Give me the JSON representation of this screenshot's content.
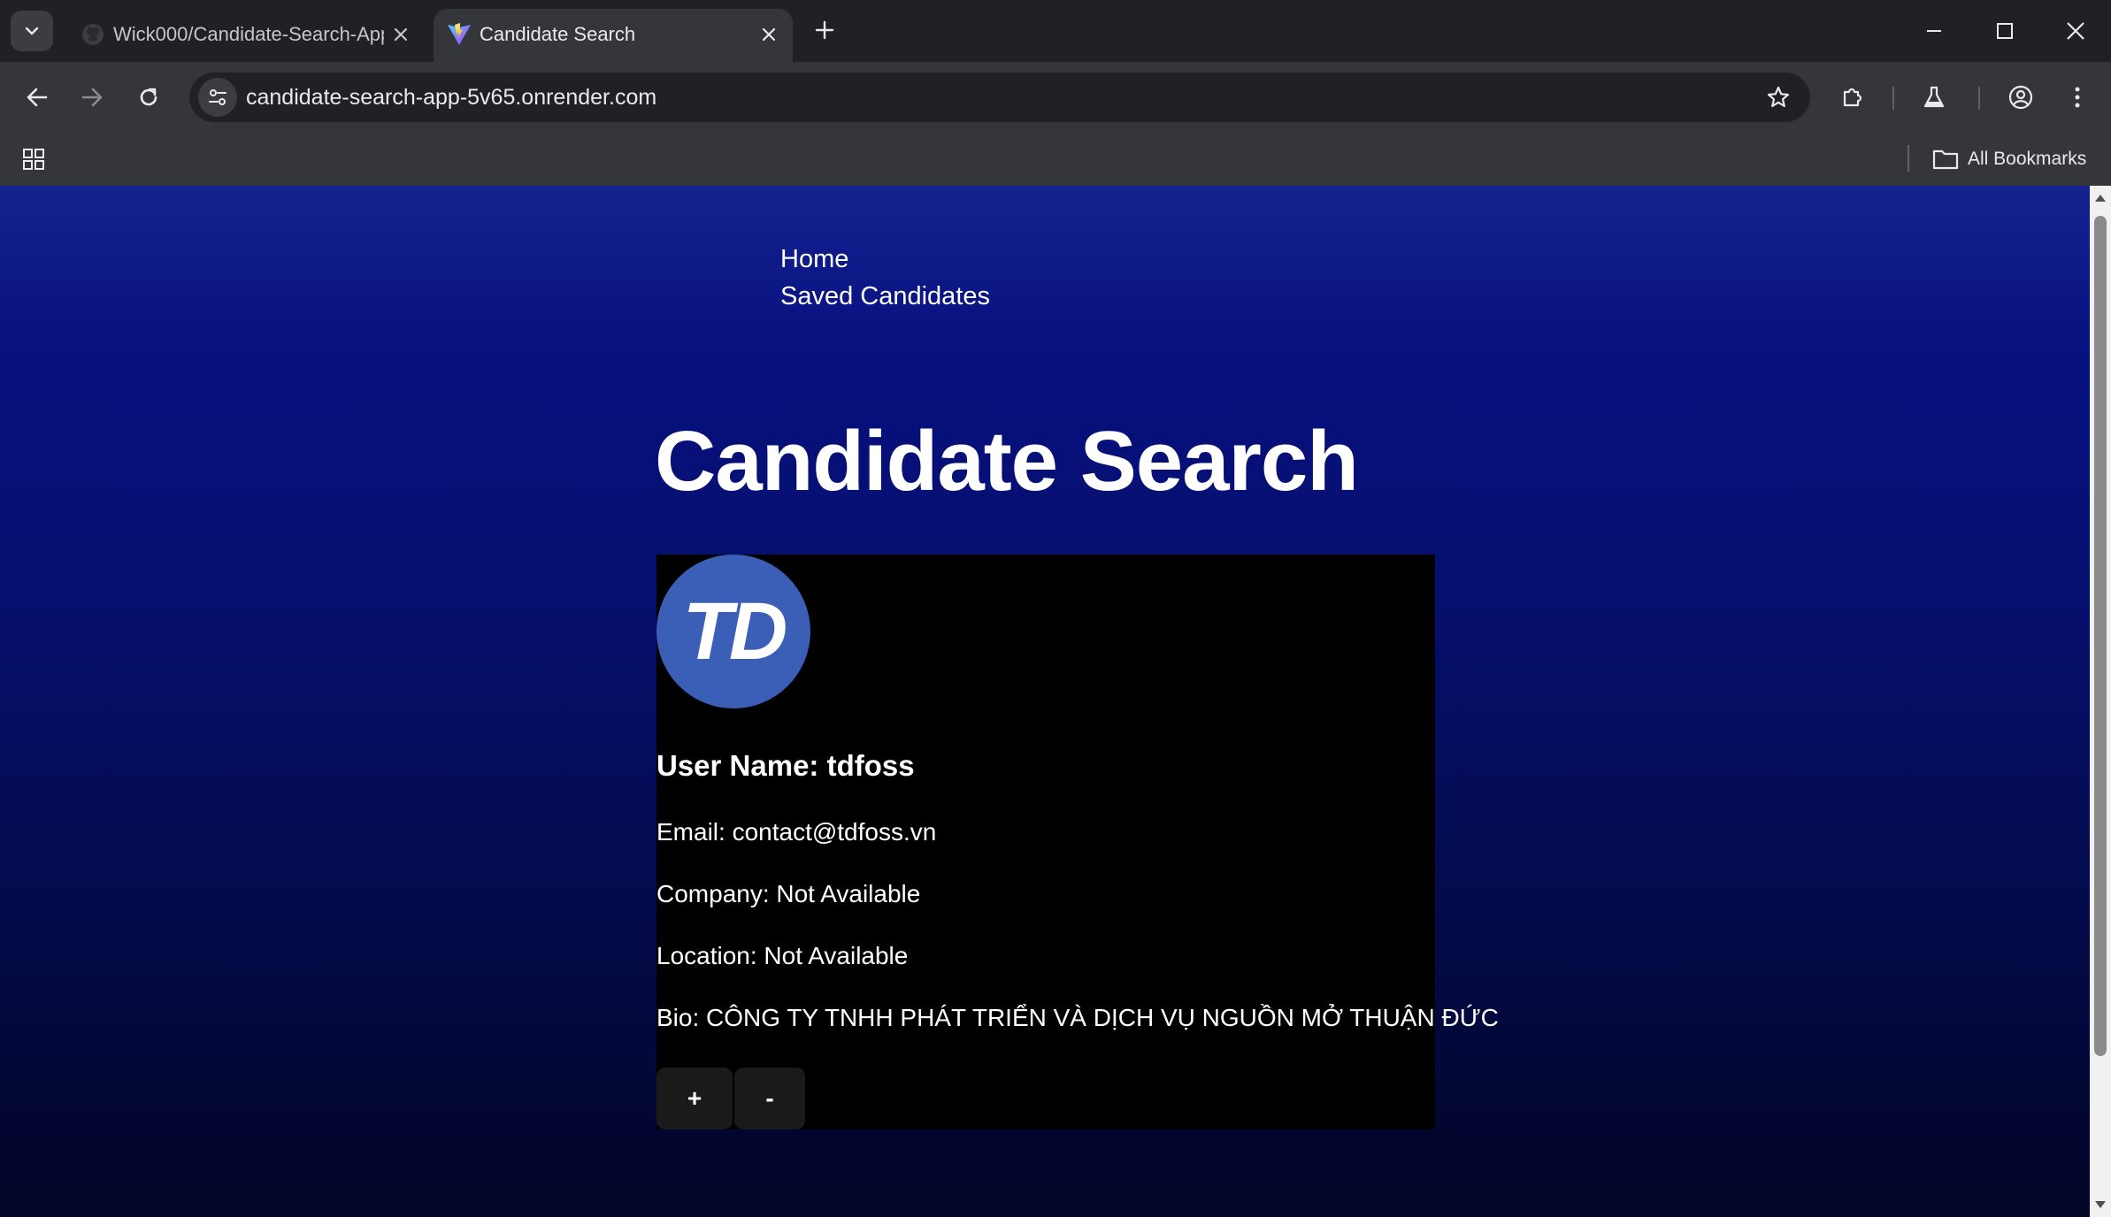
{
  "browser": {
    "tabs": [
      {
        "title": "Wick000/Candidate-Search-App"
      },
      {
        "title": "Candidate Search"
      }
    ],
    "url": "candidate-search-app-5v65.onrender.com",
    "bookmarks": {
      "all_label": "All Bookmarks"
    }
  },
  "page": {
    "nav": {
      "home": "Home",
      "saved": "Saved Candidates"
    },
    "heading": "Candidate Search",
    "candidate": {
      "avatar_text": "TD",
      "username_line": "User Name: tdfoss",
      "email_line": "Email: contact@tdfoss.vn",
      "company_line": "Company: Not Available",
      "location_line": "Location: Not Available",
      "bio_line": "Bio: CÔNG TY TNHH PHÁT TRIỂN VÀ DỊCH VỤ NGUỒN MỞ THUẬN ĐỨC"
    },
    "buttons": {
      "add": "+",
      "remove": "-"
    }
  },
  "colors": {
    "accent_avatar": "#3b5eb7",
    "page_gradient_top": "#14228f",
    "page_gradient_bottom": "#020525",
    "card_bg": "#000000"
  }
}
